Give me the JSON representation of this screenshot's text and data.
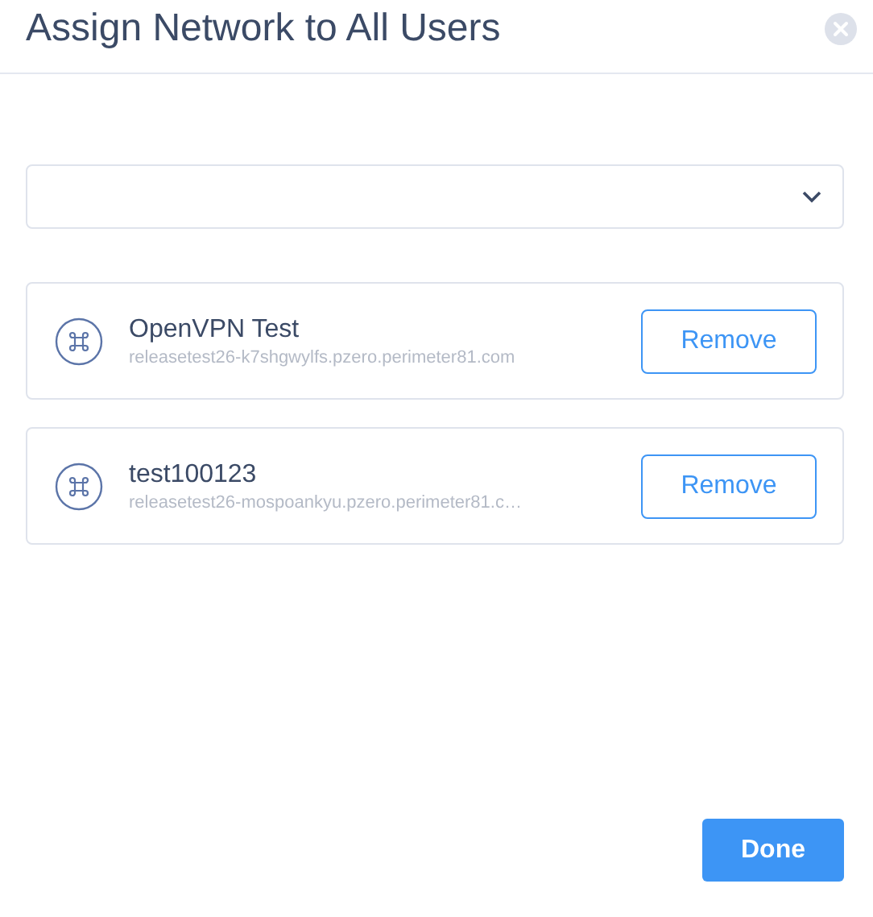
{
  "dialog": {
    "title": "Assign Network to All Users"
  },
  "networks": [
    {
      "name": "OpenVPN Test",
      "host": "releasetest26-k7shgwylfs.pzero.perimeter81.com",
      "action": "Remove"
    },
    {
      "name": "test100123",
      "host": "releasetest26-mospoankyu.pzero.perimeter81.c…",
      "action": "Remove"
    }
  ],
  "buttons": [
    {
      "label": "Done"
    }
  ]
}
